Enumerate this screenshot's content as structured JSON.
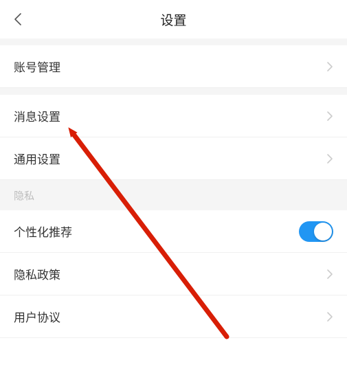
{
  "header": {
    "title": "设置"
  },
  "rows": {
    "account": "账号管理",
    "message": "消息设置",
    "general": "通用设置",
    "privacy_section": "隐私",
    "personalization": "个性化推荐",
    "privacy_policy": "隐私政策",
    "user_agreement": "用户协议"
  },
  "toggle": {
    "personalization_on": true
  },
  "colors": {
    "accent": "#2196f3",
    "arrow": "#d81e06"
  }
}
